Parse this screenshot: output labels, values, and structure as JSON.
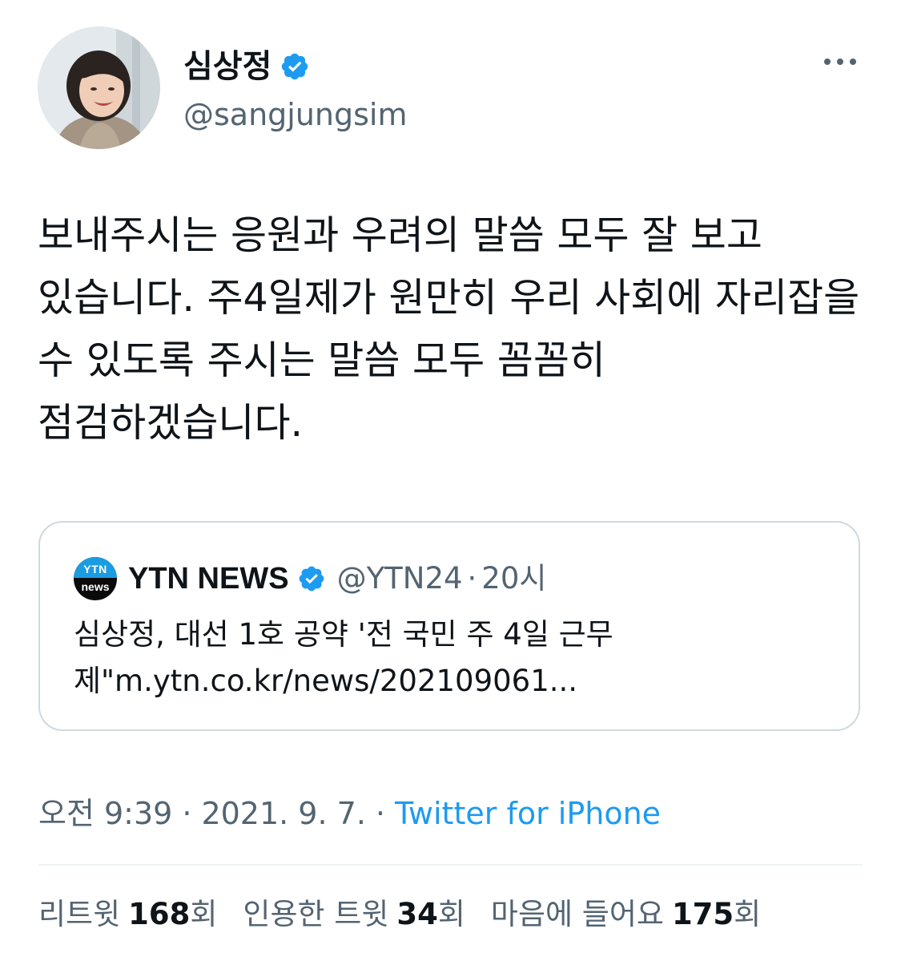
{
  "author": {
    "display_name": "심상정",
    "handle": "@sangjungsim",
    "verified": true
  },
  "tweet": {
    "text": "보내주시는 응원과 우려의 말씀 모두 잘 보고 있습니다. 주4일제가 원만히 우리 사회에 자리잡을 수 있도록 주시는 말씀 모두 꼼꼼히 점검하겠습니다."
  },
  "quote": {
    "logo_top": "YTN",
    "logo_bottom": "news",
    "name": "YTN NEWS",
    "verified": true,
    "handle": "@YTN24",
    "separator": "·",
    "time": "20시",
    "text": "심상정, 대선 1호 공약 '전 국민 주 4일 근무제\"m.ytn.co.kr/news/202109061..."
  },
  "meta": {
    "time": "오전 9:39",
    "separator": "·",
    "date": "2021. 9. 7.",
    "source": "Twitter for iPhone"
  },
  "stats": [
    {
      "label": "리트윗",
      "count": "168",
      "unit": "회"
    },
    {
      "label": "인용한 트윗",
      "count": "34",
      "unit": "회"
    },
    {
      "label": "마음에 들어요",
      "count": "175",
      "unit": "회"
    }
  ],
  "colors": {
    "accent": "#1d9bf0",
    "text_primary": "#0f1419",
    "text_secondary": "#536471",
    "border": "#cfd9de",
    "divider": "#eff3f4"
  },
  "icons": {
    "more": "more-horizontal-icon",
    "verified": "verified-badge-icon"
  }
}
